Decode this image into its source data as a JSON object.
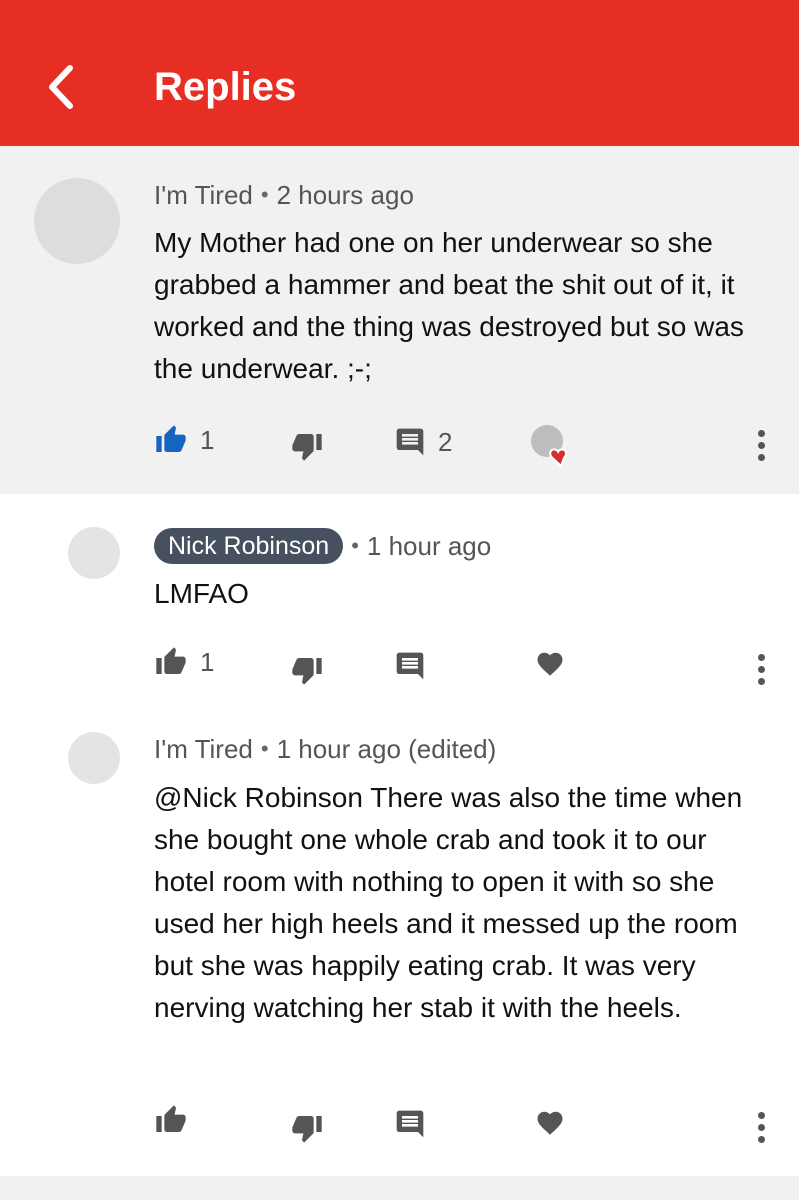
{
  "colors": {
    "brand": "#e62e25",
    "like_active": "#1565c0",
    "icon_gray": "#555555",
    "heart_red": "#d32f2f"
  },
  "header": {
    "title": "Replies",
    "back_icon": "chevron-left-icon"
  },
  "parent_comment": {
    "author": "I'm Tired",
    "separator": "•",
    "time": "2 hours ago",
    "text": "My Mother had one on her underwear so she grabbed a hammer and beat the shit out of it, it worked and the thing was destroyed but so was the underwear. ;-;",
    "likes": "1",
    "liked": true,
    "replies": "2",
    "hearted_by_creator": true
  },
  "replies": [
    {
      "author": "Nick Robinson",
      "is_owner": true,
      "separator": "•",
      "time": "1 hour ago",
      "text": "LMFAO",
      "likes": "1"
    },
    {
      "author": "I'm Tired",
      "is_owner": false,
      "separator": "•",
      "time": "1 hour ago (edited)",
      "text": "@Nick Robinson There was also the time when she bought one whole crab and took it to our hotel room with nothing to open it with so she used her high heels and it messed up the room but she was happily eating crab. It was very nerving watching her stab it with the heels.",
      "likes": ""
    }
  ]
}
